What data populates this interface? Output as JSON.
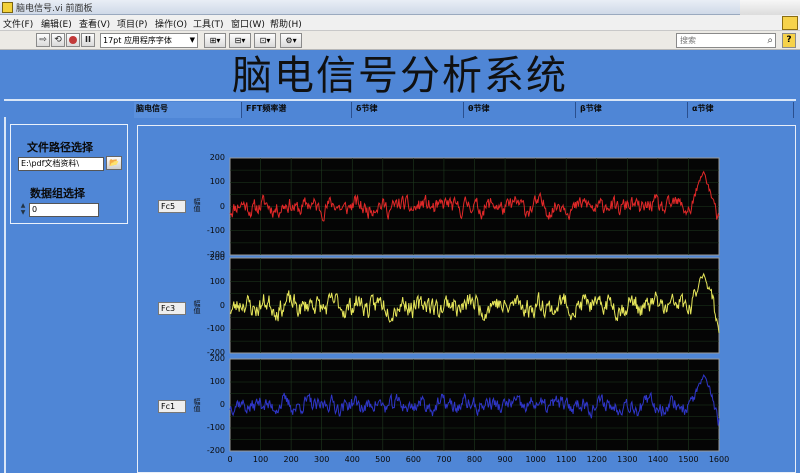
{
  "window": {
    "title": "脑电信号.vi 前面板"
  },
  "menu": [
    "文件(F)",
    "编辑(E)",
    "查看(V)",
    "项目(P)",
    "操作(O)",
    "工具(T)",
    "窗口(W)",
    "帮助(H)"
  ],
  "toolbar": {
    "font_select": "17pt 应用程序字体",
    "search_placeholder": "搜索",
    "help": "?"
  },
  "main_title": "脑电信号分析系统",
  "tabs": [
    {
      "label": "脑电信号",
      "active": true
    },
    {
      "label": "FFT频率谱",
      "active": false
    },
    {
      "label": "δ节律",
      "active": false
    },
    {
      "label": "θ节律",
      "active": false
    },
    {
      "label": "β节律",
      "active": false
    },
    {
      "label": "α节律",
      "active": false
    }
  ],
  "file_path": {
    "label": "文件路径选择",
    "value": "E:\\pdf文档资料\\"
  },
  "array_index": {
    "label": "数据组选择",
    "value": "0"
  },
  "graphs": [
    {
      "channel": "Fc5",
      "ylabel": "幅值",
      "color": "#e02828",
      "seed": 11
    },
    {
      "channel": "Fc3",
      "ylabel": "幅值",
      "color": "#e6e65a",
      "seed": 23
    },
    {
      "channel": "Fc1",
      "ylabel": "幅值",
      "color": "#2f36c8",
      "seed": 37
    }
  ],
  "y_ticks": [
    "200",
    "100",
    "0",
    "-100",
    "-200"
  ],
  "x_ticks": [
    "0",
    "100",
    "200",
    "300",
    "400",
    "500",
    "600",
    "700",
    "800",
    "900",
    "1000",
    "1100",
    "1200",
    "1300",
    "1400",
    "1500",
    "1600"
  ],
  "chart_data": {
    "type": "line",
    "x_range": [
      0,
      1600
    ],
    "y_range": [
      -200,
      200
    ],
    "grid": true,
    "series": [
      {
        "name": "Fc5",
        "approx_mean": 0,
        "approx_amplitude": 40,
        "peak_near_x": 1550,
        "peak_value": 170
      },
      {
        "name": "Fc3",
        "approx_mean": 0,
        "approx_amplitude": 50,
        "peak_near_x": 1550,
        "peak_value": 160
      },
      {
        "name": "Fc1",
        "approx_mean": 0,
        "approx_amplitude": 40,
        "peak_near_x": 1550,
        "peak_value": 150
      }
    ]
  }
}
